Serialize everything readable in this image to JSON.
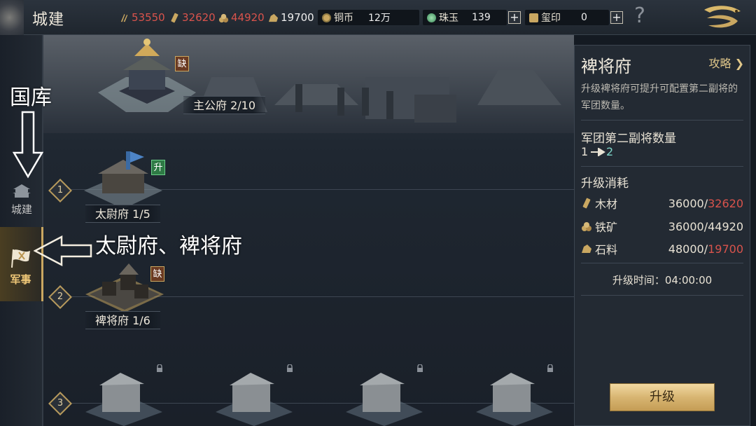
{
  "header": {
    "title": "城建",
    "resources": [
      {
        "name": "wood",
        "icon": "wood-icon",
        "value": "53550",
        "color": "#d9534c"
      },
      {
        "name": "lumber",
        "icon": "lumber-icon",
        "value": "32620",
        "color": "#d9534c"
      },
      {
        "name": "iron",
        "icon": "iron-ore-icon",
        "value": "44920",
        "color": "#d9534c"
      },
      {
        "name": "stone",
        "icon": "stone-icon",
        "value": "19700",
        "color": "#eeeeee"
      }
    ],
    "currencies": [
      {
        "name": "铜币",
        "icon": "copper-coin-icon",
        "value": "12万"
      },
      {
        "name": "珠玉",
        "icon": "jade-icon",
        "value": "139"
      },
      {
        "name": "玺印",
        "icon": "seal-icon",
        "value": "0"
      }
    ],
    "help_label": "?"
  },
  "sidebar": {
    "items": [
      {
        "label": "城建",
        "icon": "city-building-icon",
        "active": false
      },
      {
        "label": "军事",
        "icon": "military-flag-icon",
        "active": true
      }
    ]
  },
  "scene": {
    "hero": {
      "label": "主公府 2/10",
      "tag": "缺"
    },
    "tiers": [
      {
        "num": "1",
        "buildings": [
          {
            "label": "太尉府 1/5",
            "tag": "升"
          }
        ]
      },
      {
        "num": "2",
        "buildings": [
          {
            "label": "裨将府 1/6",
            "tag": "缺"
          }
        ]
      },
      {
        "num": "3",
        "buildings": []
      }
    ]
  },
  "annotations": {
    "top_label": "国库",
    "mid_label": "太尉府、裨将府"
  },
  "panel": {
    "title": "裨将府",
    "guide_label": "攻略",
    "description": "升级裨将府可提升可配置第二副将的军团数量。",
    "stat_title": "军团第二副将数量",
    "stat_from": "1",
    "stat_to": "2",
    "cost_title": "升级消耗",
    "costs": [
      {
        "name": "木材",
        "icon": "lumber-icon",
        "required": "36000",
        "have": "32620",
        "enough": false
      },
      {
        "name": "铁矿",
        "icon": "iron-ore-icon",
        "required": "36000",
        "have": "44920",
        "enough": true
      },
      {
        "name": "石料",
        "icon": "stone-icon",
        "required": "48000",
        "have": "19700",
        "enough": false
      }
    ],
    "time_label": "升级时间：04:00:00",
    "upgrade_button": "升级"
  },
  "colors": {
    "accent_gold": "#c9a761",
    "insufficient": "#d9534c",
    "arrow_teal": "#7fd6c9"
  }
}
